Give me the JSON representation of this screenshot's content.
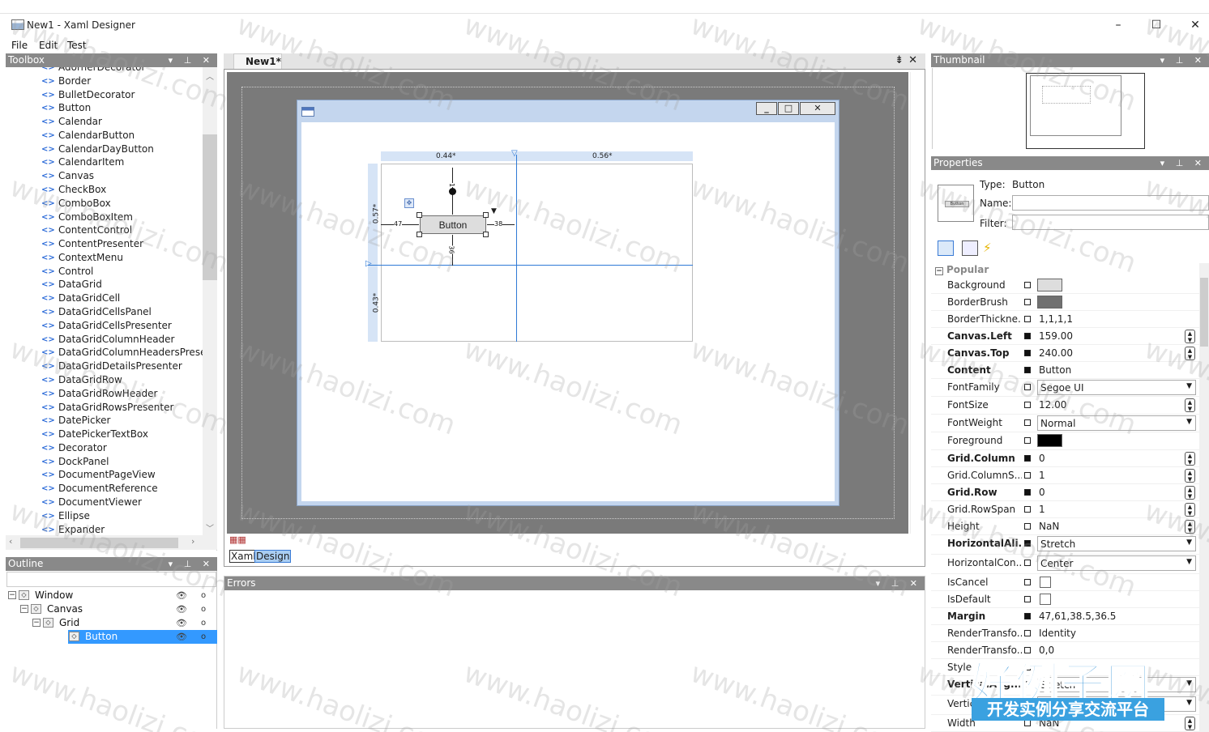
{
  "window": {
    "title": "New1 - Xaml Designer",
    "minimize": "–",
    "maximize": "☐",
    "close": "✕"
  },
  "menu": [
    "File",
    "Edit",
    "Test"
  ],
  "toolbox": {
    "title": "Toolbox",
    "items": [
      "AdornerDecorator",
      "Border",
      "BulletDecorator",
      "Button",
      "Calendar",
      "CalendarButton",
      "CalendarDayButton",
      "CalendarItem",
      "Canvas",
      "CheckBox",
      "ComboBox",
      "ComboBoxItem",
      "ContentControl",
      "ContentPresenter",
      "ContextMenu",
      "Control",
      "DataGrid",
      "DataGridCell",
      "DataGridCellsPanel",
      "DataGridCellsPresenter",
      "DataGridColumnHeader",
      "DataGridColumnHeadersPresent",
      "DataGridDetailsPresenter",
      "DataGridRow",
      "DataGridRowHeader",
      "DataGridRowsPresenter",
      "DatePicker",
      "DatePickerTextBox",
      "Decorator",
      "DockPanel",
      "DocumentPageView",
      "DocumentReference",
      "DocumentViewer",
      "Ellipse",
      "Expander"
    ]
  },
  "outline": {
    "title": "Outline",
    "nodes": [
      {
        "label": "Window",
        "depth": 0,
        "selected": false
      },
      {
        "label": "Canvas",
        "depth": 1,
        "selected": false
      },
      {
        "label": "Grid",
        "depth": 2,
        "selected": false
      },
      {
        "label": "Button",
        "depth": 3,
        "selected": true
      }
    ]
  },
  "document": {
    "tab": "New1*",
    "ruler_top_left": "0.44*",
    "ruler_top_right": "0.56*",
    "ruler_left_top": "0.57*",
    "ruler_left_bottom": "0.43*",
    "button_text": "Button",
    "margin_left": "47",
    "margin_right": "38",
    "margin_top": "1",
    "margin_bottom": "36",
    "view_tabs": [
      "Xaml",
      "Design"
    ]
  },
  "errors": {
    "title": "Errors"
  },
  "thumbnail": {
    "title": "Thumbnail"
  },
  "properties": {
    "title": "Properties",
    "type_label": "Type:",
    "type_value": "Button",
    "name_label": "Name:",
    "filter_label": "Filter:",
    "preview_text": "Button",
    "category": "Popular",
    "rows": [
      {
        "name": "Background",
        "bold": false,
        "set": false,
        "kind": "swatch",
        "color": "#dddddd"
      },
      {
        "name": "BorderBrush",
        "bold": false,
        "set": false,
        "kind": "swatch",
        "color": "#707070"
      },
      {
        "name": "BorderThickne...",
        "bold": false,
        "set": false,
        "kind": "text",
        "value": "1,1,1,1"
      },
      {
        "name": "Canvas.Left",
        "bold": true,
        "set": true,
        "kind": "spin",
        "value": "159.00"
      },
      {
        "name": "Canvas.Top",
        "bold": true,
        "set": true,
        "kind": "spin",
        "value": "240.00"
      },
      {
        "name": "Content",
        "bold": true,
        "set": true,
        "kind": "text",
        "value": "Button"
      },
      {
        "name": "FontFamily",
        "bold": false,
        "set": false,
        "kind": "combo",
        "value": "Segoe UI"
      },
      {
        "name": "FontSize",
        "bold": false,
        "set": false,
        "kind": "spin",
        "value": "12.00"
      },
      {
        "name": "FontWeight",
        "bold": false,
        "set": false,
        "kind": "combo",
        "value": "Normal"
      },
      {
        "name": "Foreground",
        "bold": false,
        "set": false,
        "kind": "swatch",
        "color": "#000000"
      },
      {
        "name": "Grid.Column",
        "bold": true,
        "set": true,
        "kind": "spin",
        "value": "0"
      },
      {
        "name": "Grid.ColumnS...",
        "bold": false,
        "set": false,
        "kind": "spin",
        "value": "1"
      },
      {
        "name": "Grid.Row",
        "bold": true,
        "set": true,
        "kind": "spin",
        "value": "0"
      },
      {
        "name": "Grid.RowSpan",
        "bold": false,
        "set": false,
        "kind": "spin",
        "value": "1"
      },
      {
        "name": "Height",
        "bold": false,
        "set": false,
        "kind": "spin",
        "value": "NaN"
      },
      {
        "name": "HorizontalAli...",
        "bold": true,
        "set": true,
        "kind": "combo",
        "value": "Stretch"
      },
      {
        "name": "HorizontalCon...",
        "bold": false,
        "set": false,
        "kind": "combo",
        "value": "Center"
      },
      {
        "name": "IsCancel",
        "bold": false,
        "set": false,
        "kind": "check"
      },
      {
        "name": "IsDefault",
        "bold": false,
        "set": false,
        "kind": "check"
      },
      {
        "name": "Margin",
        "bold": true,
        "set": true,
        "kind": "text",
        "value": "47,61,38.5,36.5"
      },
      {
        "name": "RenderTransfo...",
        "bold": false,
        "set": false,
        "kind": "text",
        "value": "Identity"
      },
      {
        "name": "RenderTransfo...",
        "bold": false,
        "set": false,
        "kind": "text",
        "value": "0,0"
      },
      {
        "name": "Style",
        "bold": false,
        "set": false,
        "kind": "text",
        "value": ""
      },
      {
        "name": "VerticalAlig...",
        "bold": true,
        "set": true,
        "kind": "combo",
        "value": "Stretch"
      },
      {
        "name": "VerticalCon...",
        "bold": false,
        "set": false,
        "kind": "combo",
        "value": "Center"
      },
      {
        "name": "Width",
        "bold": false,
        "set": false,
        "kind": "spin",
        "value": "NaN"
      }
    ]
  },
  "watermark": {
    "text": "www.haolizi.com",
    "logo_main": "好例子网",
    "logo_sub": "开发实例分享交流平台"
  }
}
